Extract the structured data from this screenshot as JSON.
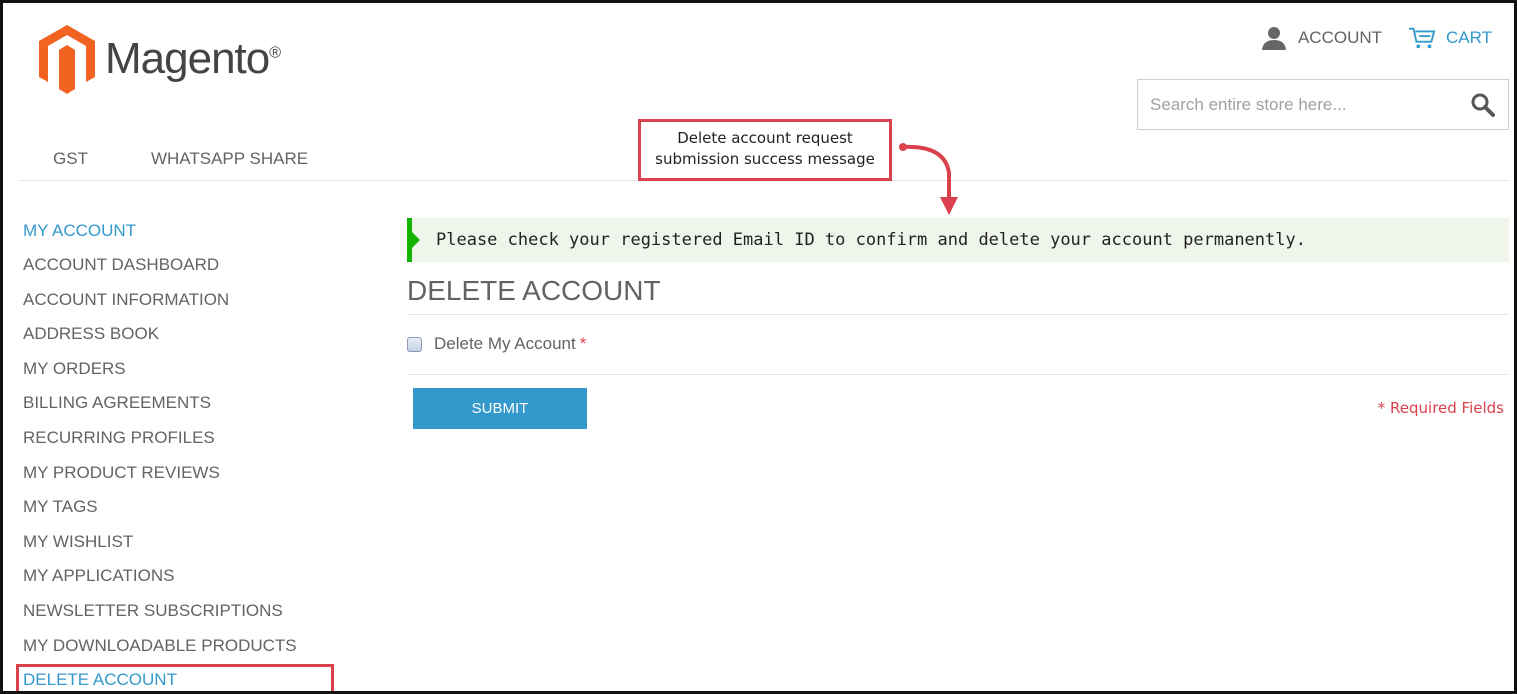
{
  "header": {
    "logo_text": "Magento",
    "logo_reg": "®",
    "account_label": "ACCOUNT",
    "cart_label": "CART",
    "search_placeholder": "Search entire store here...",
    "brand_color": "#3399cc",
    "logo_color": "#f26322"
  },
  "nav": {
    "items": [
      "GST",
      "WHATSAPP SHARE"
    ]
  },
  "callout": {
    "line1": "Delete account request",
    "line2": "submission success message",
    "color": "#d9414d"
  },
  "sidebar": {
    "title": "MY ACCOUNT",
    "items": [
      "ACCOUNT DASHBOARD",
      "ACCOUNT INFORMATION",
      "ADDRESS BOOK",
      "MY ORDERS",
      "BILLING AGREEMENTS",
      "RECURRING PROFILES",
      "MY PRODUCT REVIEWS",
      "MY TAGS",
      "MY WISHLIST",
      "MY APPLICATIONS",
      "NEWSLETTER SUBSCRIPTIONS",
      "MY DOWNLOADABLE PRODUCTS",
      "DELETE ACCOUNT"
    ],
    "active": "DELETE ACCOUNT"
  },
  "main": {
    "success_message": "Please check your registered Email ID to confirm and delete your account permanently.",
    "title": "DELETE ACCOUNT",
    "checkbox_label": "Delete My Account",
    "required_star": "*",
    "submit_label": "SUBMIT",
    "required_fields": "* Required Fields",
    "success_accent": "#11b400"
  }
}
